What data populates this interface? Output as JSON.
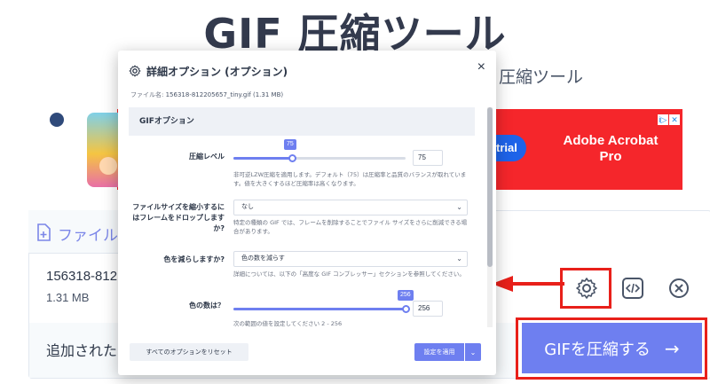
{
  "page": {
    "title": "GIF 圧縮ツール",
    "subtitle": "圧縮ツール"
  },
  "ad": {
    "trial_text": "trial",
    "brand": "Adobe Acrobat Pro",
    "badge_info": "i▷",
    "badge_close": "✕"
  },
  "file_panel": {
    "header_label": "ファイル",
    "file_name": "156318-812",
    "file_size": "1.31 MB",
    "added_label": "追加された"
  },
  "actions": {
    "compress_label": "GIFを圧縮する",
    "compress_arrow": "→"
  },
  "modal": {
    "title": "詳細オプション (オプション)",
    "close": "×",
    "filename_label": "ファイル名:",
    "filename_value": "156318-812205657_tiny.gif (1.31 MB)",
    "section_title": "GIFオプション",
    "compression": {
      "label": "圧縮レベル",
      "value": "75",
      "slider_fraction": 0.34,
      "help": "非可逆LZW圧縮を適用します。デフォルト（75）は圧縮率と品質のバランスが取れています。値を大きくするほど圧縮率は高くなります。"
    },
    "drop_frames": {
      "label": "ファイルサイズを縮小するにはフレームをドロップしますか?",
      "selected": "なし",
      "help": "特定の種類の GIF では、フレームを削除することでファイル サイズをさらに削減できる場合があります。"
    },
    "reduce_colors": {
      "label": "色を減らしますか?",
      "selected": "色の数を減らす",
      "help": "詳細については、以下の「高度な GIF コンプレッサー」セクションを参照してください。"
    },
    "color_count": {
      "label": "色の数は？",
      "value": "256",
      "slider_fraction": 1.0,
      "help": "次の範囲の値を設定してください 2 - 256"
    },
    "reset_label": "すべてのオプションをリセット",
    "apply_label": "設定を適用",
    "apply_chevron": "⌄"
  },
  "colors": {
    "accent": "#6e7ff0",
    "highlight": "#e8201a",
    "ad_red": "#f5262b"
  }
}
